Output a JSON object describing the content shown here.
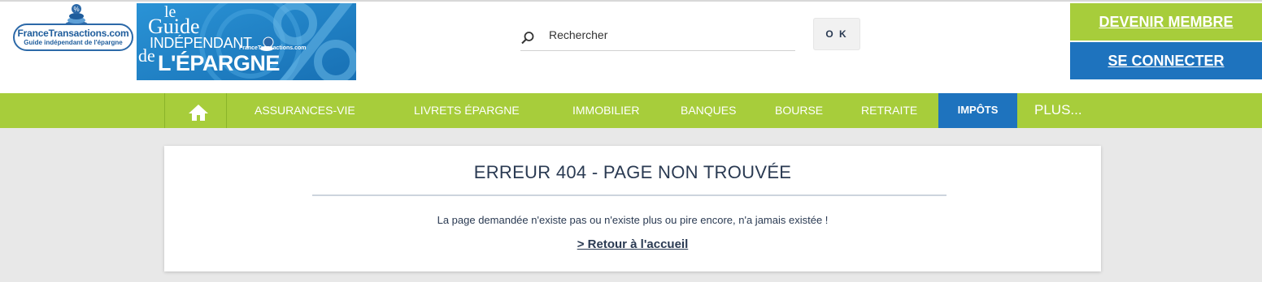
{
  "header": {
    "logo": {
      "name_part1": "France",
      "name_part2": "Transactions.com",
      "tagline": "Guide indépendant de l'épargne"
    },
    "banner": {
      "line_le": "le",
      "line_guide": "Guide",
      "line_independant": "INDÉPENDANT",
      "line_de": "de",
      "line_epargne": "L'ÉPARGNE",
      "small_brand": "FranceTransactions.com"
    },
    "search": {
      "placeholder": "Rechercher",
      "icon": "search-icon",
      "submit_label": "O K"
    },
    "account": {
      "member_label": "DEVENIR MEMBRE",
      "login_label": "SE CONNECTER"
    }
  },
  "nav": {
    "home_icon": "home-icon",
    "items": [
      {
        "label": "ASSURANCES-VIE"
      },
      {
        "label": "LIVRETS ÉPARGNE"
      },
      {
        "label": "IMMOBILIER"
      },
      {
        "label": "BANQUES"
      },
      {
        "label": "BOURSE"
      },
      {
        "label": "RETRAITE"
      },
      {
        "label": "IMPÔTS",
        "active": true
      },
      {
        "label": "PLUS..."
      }
    ]
  },
  "error": {
    "title": "ERREUR 404 - PAGE NON TROUVÉE",
    "message": "La page demandée n'existe pas ou n'existe plus ou pire encore, n'a jamais existée !",
    "back_link": "> Retour à l'accueil"
  },
  "colors": {
    "green": "#a7cd3b",
    "blue": "#1e73be",
    "text": "#2a3a52",
    "page_bg": "#e8e8e8"
  }
}
